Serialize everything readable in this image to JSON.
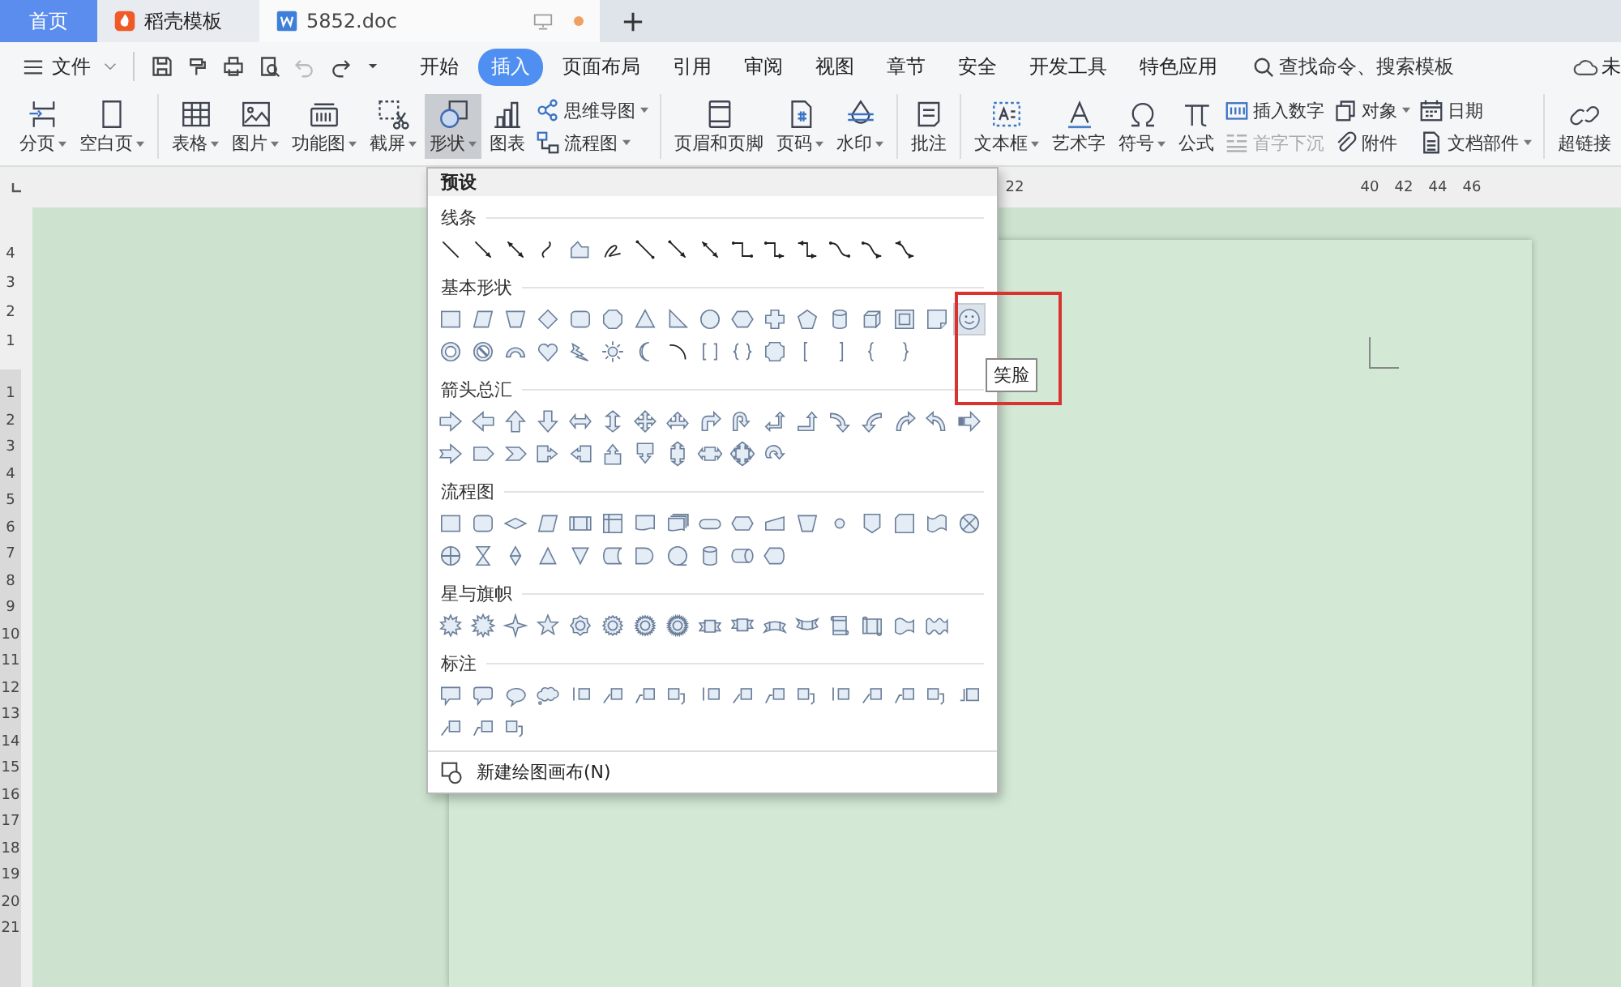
{
  "tabs": [
    {
      "kind": "home",
      "label": "首页",
      "selected": false
    },
    {
      "kind": "docer",
      "label": "稻壳模板",
      "selected": false
    },
    {
      "kind": "document",
      "label": "5852.doc",
      "selected": true,
      "unsaved": true
    }
  ],
  "menu": {
    "file_label": "文件",
    "quick_access": [
      {
        "kind": "save",
        "disabled": false
      },
      {
        "kind": "painter",
        "disabled": false
      },
      {
        "kind": "print",
        "disabled": false
      },
      {
        "kind": "preview",
        "disabled": false
      },
      {
        "kind": "undo",
        "disabled": true
      },
      {
        "kind": "redo",
        "disabled": false
      },
      {
        "kind": "more",
        "disabled": false
      }
    ],
    "tabs": [
      {
        "label": "开始",
        "selected": false
      },
      {
        "label": "插入",
        "selected": true
      },
      {
        "label": "页面布局",
        "selected": false
      },
      {
        "label": "引用",
        "selected": false
      },
      {
        "label": "审阅",
        "selected": false
      },
      {
        "label": "视图",
        "selected": false
      },
      {
        "label": "章节",
        "selected": false
      },
      {
        "label": "安全",
        "selected": false
      },
      {
        "label": "开发工具",
        "selected": false
      },
      {
        "label": "特色应用",
        "selected": false
      }
    ],
    "search": {
      "placeholder": "查找命令、搜索模板"
    },
    "sync_label": "未"
  },
  "ribbon": {
    "groups": [
      {
        "items": [
          {
            "kind": "large",
            "label": "分页",
            "dropdown": true,
            "selected": false
          },
          {
            "kind": "large",
            "label": "空白页",
            "dropdown": true,
            "selected": false
          }
        ]
      },
      {
        "items": [
          {
            "kind": "large",
            "label": "表格",
            "dropdown": true,
            "selected": false
          },
          {
            "kind": "large",
            "label": "图片",
            "dropdown": true,
            "selected": false
          },
          {
            "kind": "large",
            "label": "功能图",
            "dropdown": true,
            "selected": false
          },
          {
            "kind": "large",
            "label": "截屏",
            "dropdown": true,
            "selected": false
          },
          {
            "kind": "large",
            "label": "形状",
            "dropdown": true,
            "selected": true
          },
          {
            "kind": "large",
            "label": "图表",
            "dropdown": false,
            "selected": false
          },
          {
            "kind": "stack",
            "items": [
              {
                "label": "思维导图",
                "dropdown": true,
                "disabled": false
              },
              {
                "label": "流程图",
                "dropdown": true,
                "disabled": false
              }
            ]
          }
        ]
      },
      {
        "items": [
          {
            "kind": "large",
            "label": "页眉和页脚",
            "dropdown": false,
            "selected": false
          },
          {
            "kind": "large",
            "label": "页码",
            "dropdown": true,
            "selected": false
          },
          {
            "kind": "large",
            "label": "水印",
            "dropdown": true,
            "selected": false
          }
        ]
      },
      {
        "items": [
          {
            "kind": "large",
            "label": "批注",
            "dropdown": false,
            "selected": false
          }
        ]
      },
      {
        "items": [
          {
            "kind": "large",
            "label": "文本框",
            "dropdown": true,
            "selected": false
          },
          {
            "kind": "large",
            "label": "艺术字",
            "dropdown": false,
            "selected": false
          },
          {
            "kind": "large",
            "label": "符号",
            "dropdown": true,
            "selected": false
          },
          {
            "kind": "large",
            "label": "公式",
            "dropdown": false,
            "selected": false
          },
          {
            "kind": "stack",
            "items": [
              {
                "label": "插入数字",
                "dropdown": false,
                "disabled": false
              },
              {
                "label": "首字下沉",
                "dropdown": false,
                "disabled": true
              }
            ]
          },
          {
            "kind": "stack",
            "items": [
              {
                "label": "对象",
                "dropdown": true,
                "disabled": false
              },
              {
                "label": "附件",
                "dropdown": false,
                "disabled": false
              }
            ]
          },
          {
            "kind": "stack",
            "items": [
              {
                "label": "日期",
                "dropdown": false,
                "disabled": false
              },
              {
                "label": "文档部件",
                "dropdown": true,
                "disabled": false
              }
            ]
          }
        ]
      },
      {
        "items": [
          {
            "kind": "large",
            "label": "超链接",
            "dropdown": false,
            "selected": false
          }
        ]
      }
    ]
  },
  "ruler": {
    "numbers": [
      "22",
      "40",
      "42",
      "44",
      "46"
    ],
    "vertical_margin_numbers": [
      "4",
      "3",
      "2",
      "1"
    ],
    "vertical_numbers": [
      "1",
      "2",
      "3",
      "4",
      "5",
      "6",
      "7",
      "8",
      "9",
      "10",
      "11",
      "12",
      "13",
      "14",
      "15",
      "16",
      "17",
      "18",
      "19",
      "20",
      "21"
    ]
  },
  "shapes_panel": {
    "title": "预设",
    "sections": [
      {
        "title": "线条",
        "shapes": [
          {
            "kind": "line",
            "selected": false
          },
          {
            "kind": "arrow",
            "selected": false
          },
          {
            "kind": "darrow",
            "selected": false
          },
          {
            "kind": "curve",
            "selected": false
          },
          {
            "kind": "freeform",
            "selected": false
          },
          {
            "kind": "scribble",
            "selected": false
          },
          {
            "kind": "connector",
            "selected": false
          },
          {
            "kind": "connectorarrow",
            "selected": false
          },
          {
            "kind": "connectordarrow",
            "selected": false
          },
          {
            "kind": "elbow",
            "selected": false
          },
          {
            "kind": "elbowarrow",
            "selected": false
          },
          {
            "kind": "elbowdarrow",
            "selected": false
          },
          {
            "kind": "curvedconn",
            "selected": false
          },
          {
            "kind": "curvedarrow",
            "selected": false
          },
          {
            "kind": "curveddarrow",
            "selected": false
          }
        ]
      },
      {
        "title": "基本形状",
        "shapes": [
          {
            "kind": "rect",
            "selected": false
          },
          {
            "kind": "parallelogram",
            "selected": false
          },
          {
            "kind": "trapezoid",
            "selected": false
          },
          {
            "kind": "diamond",
            "selected": false
          },
          {
            "kind": "roundrect",
            "selected": false
          },
          {
            "kind": "octagon",
            "selected": false
          },
          {
            "kind": "triangle",
            "selected": false
          },
          {
            "kind": "rtriangle",
            "selected": false
          },
          {
            "kind": "circle",
            "selected": false
          },
          {
            "kind": "hexagon",
            "selected": false
          },
          {
            "kind": "cross",
            "selected": false
          },
          {
            "kind": "pentagon",
            "selected": false
          },
          {
            "kind": "cylinder",
            "selected": false
          },
          {
            "kind": "cube",
            "selected": false
          },
          {
            "kind": "frame",
            "selected": false
          },
          {
            "kind": "folded",
            "selected": false
          },
          {
            "kind": "smiley",
            "selected": true
          },
          {
            "kind": "donut",
            "selected": false
          },
          {
            "kind": "nosign",
            "selected": false
          },
          {
            "kind": "arc",
            "selected": false
          },
          {
            "kind": "heart",
            "selected": false
          },
          {
            "kind": "lightning",
            "selected": false
          },
          {
            "kind": "sun",
            "selected": false
          },
          {
            "kind": "moon",
            "selected": false
          },
          {
            "kind": "arcline",
            "selected": false
          },
          {
            "kind": "bracket",
            "selected": false
          },
          {
            "kind": "brace",
            "selected": false
          },
          {
            "kind": "plaque",
            "selected": false
          },
          {
            "kind": "lbracket",
            "selected": false
          },
          {
            "kind": "rbracket",
            "selected": false
          },
          {
            "kind": "lbrace",
            "selected": false
          },
          {
            "kind": "rbrace",
            "selected": false
          }
        ]
      },
      {
        "title": "箭头总汇",
        "shapes": [
          {
            "kind": "arrowright",
            "selected": false
          },
          {
            "kind": "arrowleft",
            "selected": false
          },
          {
            "kind": "arrowup",
            "selected": false
          },
          {
            "kind": "arrowdown",
            "selected": false
          },
          {
            "kind": "arrowlr",
            "selected": false
          },
          {
            "kind": "arrowud",
            "selected": false
          },
          {
            "kind": "arrowquad",
            "selected": false
          },
          {
            "kind": "arrowtri",
            "selected": false
          },
          {
            "kind": "bent",
            "selected": false
          },
          {
            "kind": "uturn",
            "selected": false
          },
          {
            "kind": "leftup",
            "selected": false
          },
          {
            "kind": "bentup",
            "selected": false
          },
          {
            "kind": "curvedright",
            "selected": false
          },
          {
            "kind": "curvedleft",
            "selected": false
          },
          {
            "kind": "curvedup",
            "selected": false
          },
          {
            "kind": "curveddown",
            "selected": false
          },
          {
            "kind": "striped",
            "selected": false
          },
          {
            "kind": "notched",
            "selected": false
          },
          {
            "kind": "pentarrow",
            "selected": false
          },
          {
            "kind": "chevron",
            "selected": false
          },
          {
            "kind": "rightcallout",
            "selected": false
          },
          {
            "kind": "leftcallout",
            "selected": false
          },
          {
            "kind": "upcallout",
            "selected": false
          },
          {
            "kind": "downcallout",
            "selected": false
          },
          {
            "kind": "udcallout",
            "selected": false
          },
          {
            "kind": "lrcallout",
            "selected": false
          },
          {
            "kind": "quadcallout",
            "selected": false
          },
          {
            "kind": "circular",
            "selected": false
          }
        ]
      },
      {
        "title": "流程图",
        "shapes": [
          {
            "kind": "rect",
            "selected": false
          },
          {
            "kind": "roundrect",
            "selected": false
          },
          {
            "kind": "decision",
            "selected": false
          },
          {
            "kind": "parallelogram",
            "selected": false
          },
          {
            "kind": "predefined",
            "selected": false
          },
          {
            "kind": "internalstorage",
            "selected": false
          },
          {
            "kind": "document",
            "selected": false
          },
          {
            "kind": "multidoc",
            "selected": false
          },
          {
            "kind": "terminator",
            "selected": false
          },
          {
            "kind": "preparation",
            "selected": false
          },
          {
            "kind": "manualinput",
            "selected": false
          },
          {
            "kind": "trapezoid",
            "selected": false
          },
          {
            "kind": "connectorcircle",
            "selected": false
          },
          {
            "kind": "offpage",
            "selected": false
          },
          {
            "kind": "card",
            "selected": false
          },
          {
            "kind": "punchtape",
            "selected": false
          },
          {
            "kind": "orjunction",
            "selected": false
          },
          {
            "kind": "sumjunction",
            "selected": false
          },
          {
            "kind": "collate",
            "selected": false
          },
          {
            "kind": "sort",
            "selected": false
          },
          {
            "kind": "extract",
            "selected": false
          },
          {
            "kind": "merge",
            "selected": false
          },
          {
            "kind": "storeddata",
            "selected": false
          },
          {
            "kind": "delay",
            "selected": false
          },
          {
            "kind": "seqaccess",
            "selected": false
          },
          {
            "kind": "cylinder",
            "selected": false
          },
          {
            "kind": "directaccess",
            "selected": false
          },
          {
            "kind": "display",
            "selected": false
          }
        ]
      },
      {
        "title": "星与旗帜",
        "shapes": [
          {
            "kind": "burst",
            "selected": false
          },
          {
            "kind": "burst2",
            "selected": false
          },
          {
            "kind": "star4",
            "selected": false
          },
          {
            "kind": "star5",
            "selected": false
          },
          {
            "kind": "seal8",
            "selected": false
          },
          {
            "kind": "seal16",
            "selected": false
          },
          {
            "kind": "seal24",
            "selected": false
          },
          {
            "kind": "seal32",
            "selected": false
          },
          {
            "kind": "ribbon",
            "selected": false
          },
          {
            "kind": "ribbonup",
            "selected": false
          },
          {
            "kind": "curvedribbon",
            "selected": false
          },
          {
            "kind": "curvedribbonup",
            "selected": false
          },
          {
            "kind": "vscroll",
            "selected": false
          },
          {
            "kind": "hscroll",
            "selected": false
          },
          {
            "kind": "wave",
            "selected": false
          },
          {
            "kind": "doublewave",
            "selected": false
          }
        ]
      },
      {
        "title": "标注",
        "shapes": [
          {
            "kind": "rectcallout",
            "selected": false
          },
          {
            "kind": "roundcallout",
            "selected": false
          },
          {
            "kind": "ovalcallout",
            "selected": false
          },
          {
            "kind": "cloudcallout",
            "selected": false
          },
          {
            "kind": "barcallout",
            "selected": false
          },
          {
            "kind": "linecallout",
            "selected": false
          },
          {
            "kind": "bentcallout",
            "selected": false
          },
          {
            "kind": "curlcallout",
            "selected": false
          },
          {
            "kind": "barcallout",
            "selected": false
          },
          {
            "kind": "linecallout",
            "selected": false
          },
          {
            "kind": "bentcallout",
            "selected": false
          },
          {
            "kind": "curlcallout",
            "selected": false
          },
          {
            "kind": "barcallout",
            "selected": false
          },
          {
            "kind": "linecallout",
            "selected": false
          },
          {
            "kind": "bentcallout",
            "selected": false
          },
          {
            "kind": "curlcallout",
            "selected": false
          },
          {
            "kind": "boxbarcallout",
            "selected": false
          },
          {
            "kind": "linecallout",
            "selected": false
          },
          {
            "kind": "bentcallout",
            "selected": false
          },
          {
            "kind": "curlcallout",
            "selected": false
          }
        ]
      }
    ],
    "footer": {
      "label": "新建绘图画布(N)"
    }
  },
  "tooltip": {
    "text": "笑脸"
  }
}
